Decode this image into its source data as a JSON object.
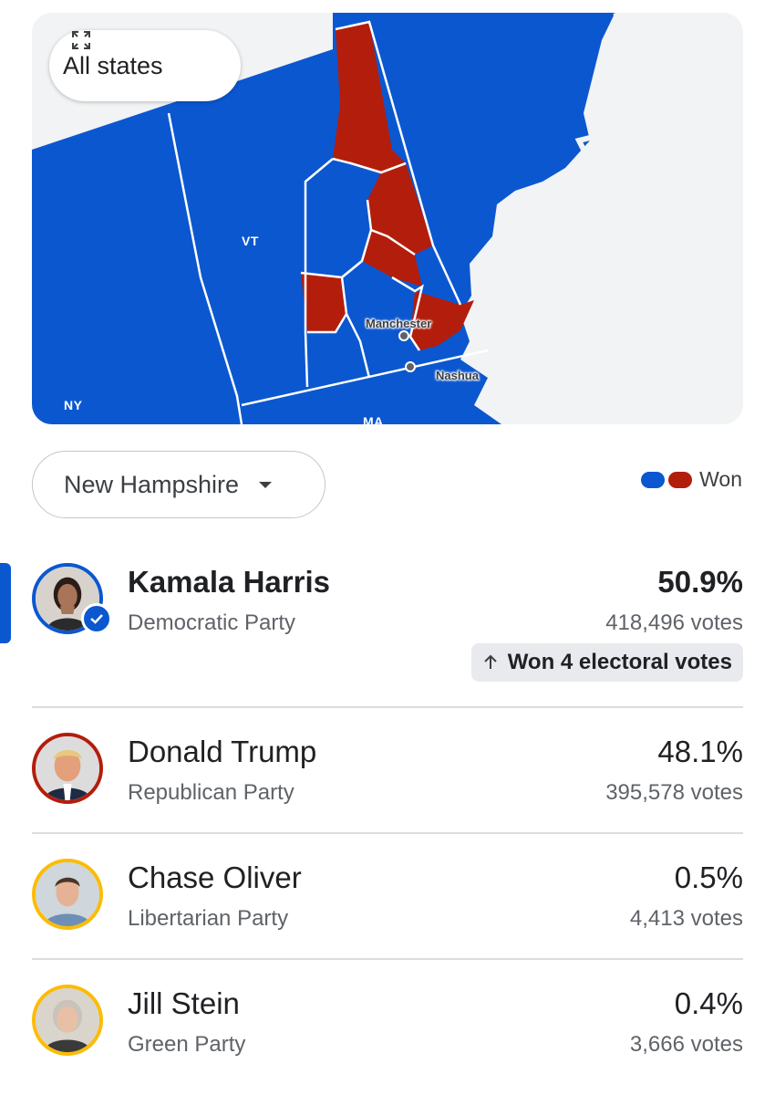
{
  "map": {
    "expand_button_label": "All states",
    "state_labels": {
      "vt": "VT",
      "ny": "NY",
      "ma": "MA"
    },
    "cities": [
      {
        "name": "Manchester"
      },
      {
        "name": "Nashua"
      }
    ],
    "colors": {
      "dem": "#0b57d0",
      "rep": "#b31d0c",
      "water": "#f1f3f4"
    }
  },
  "selector": {
    "state": "New Hampshire",
    "icon": "chevron-down-icon"
  },
  "legend": {
    "label": "Won"
  },
  "candidates": [
    {
      "name": "Kamala Harris",
      "party": "Democratic Party",
      "percent": "50.9%",
      "votes": "418,496 votes",
      "ring_color": "#0b57d0",
      "winner": true,
      "badge": "Won 4 electoral votes"
    },
    {
      "name": "Donald Trump",
      "party": "Republican Party",
      "percent": "48.1%",
      "votes": "395,578 votes",
      "ring_color": "#b31d0c"
    },
    {
      "name": "Chase Oliver",
      "party": "Libertarian Party",
      "percent": "0.5%",
      "votes": "4,413 votes",
      "ring_color": "#fbbc04"
    },
    {
      "name": "Jill Stein",
      "party": "Green Party",
      "percent": "0.4%",
      "votes": "3,666 votes",
      "ring_color": "#fbbc04"
    }
  ]
}
